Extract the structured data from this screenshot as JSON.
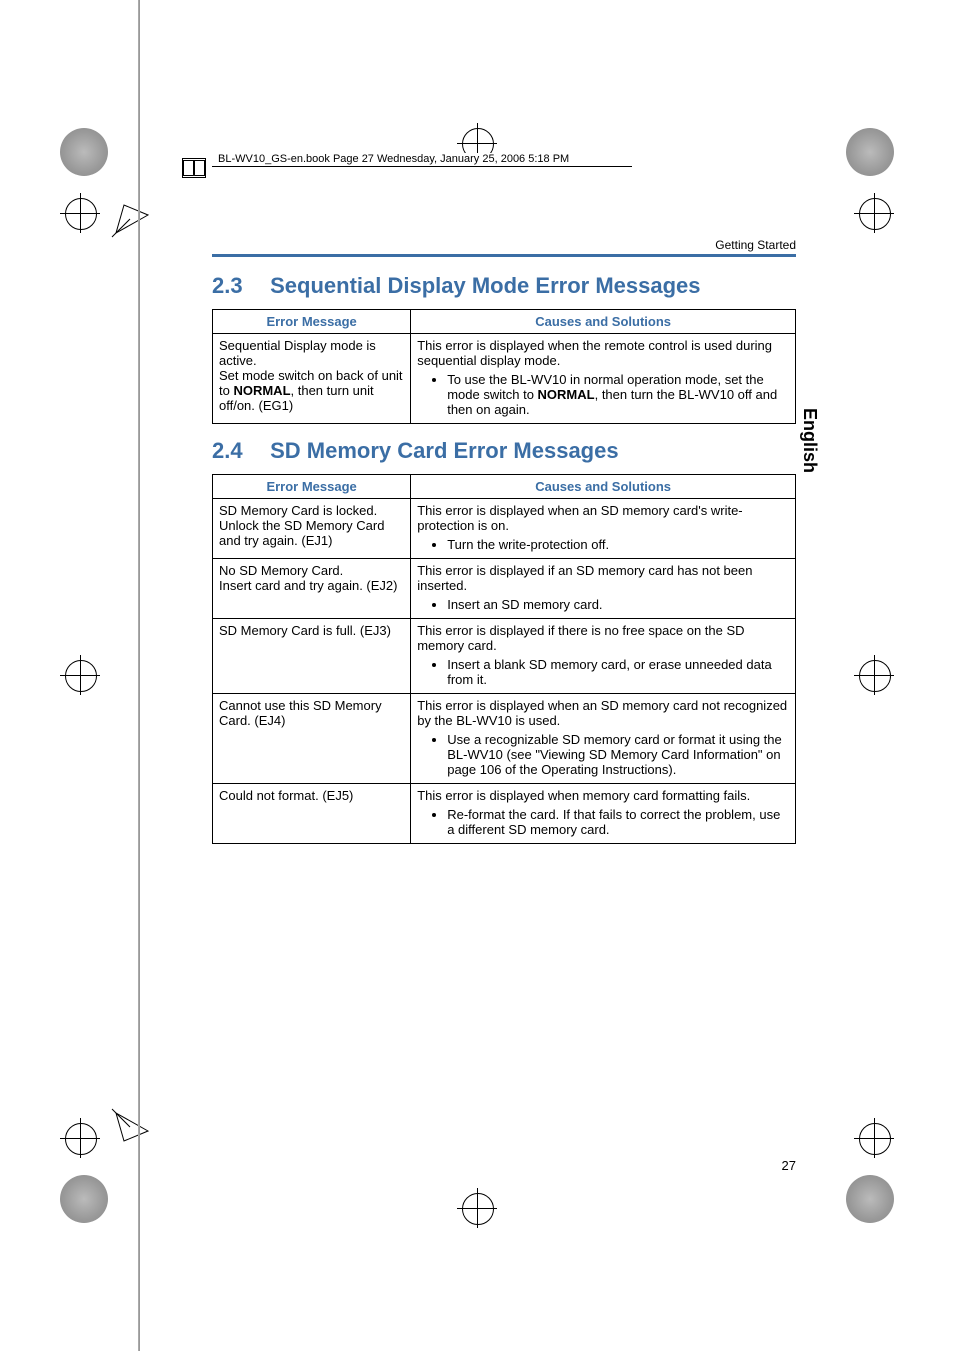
{
  "frameMaker": {
    "bookInfo": "BL-WV10_GS-en.book  Page 27  Wednesday, January 25, 2006  5:18 PM"
  },
  "runningHead": "Getting Started",
  "sideTab": "English",
  "pageNumber": "27",
  "section23": {
    "number": "2.3",
    "title": "Sequential Display Mode Error Messages",
    "headers": {
      "c1": "Error Message",
      "c2": "Causes and Solutions"
    },
    "row1": {
      "msgLine1": "Sequential Display mode is active.",
      "msgLine2a": "Set mode switch on back of unit to ",
      "msgLine2bold": "NORMAL",
      "msgLine2b": ", then turn unit off/on. (EG1)",
      "explain": "This error is displayed when the remote control is used during sequential display mode.",
      "bullet1a": "To use the BL-WV10 in normal operation mode, set the mode switch to ",
      "bullet1bold": "NORMAL",
      "bullet1b": ", then turn the BL-WV10 off and then on again."
    }
  },
  "section24": {
    "number": "2.4",
    "title": "SD Memory Card Error Messages",
    "headers": {
      "c1": "Error Message",
      "c2": "Causes and Solutions"
    },
    "rows": [
      {
        "msg1": "SD Memory Card is locked.",
        "msg2": "Unlock the SD Memory Card and try again. (EJ1)",
        "explain": "This error is displayed when an SD memory card's write-protection is on.",
        "bullet": "Turn the write-protection off."
      },
      {
        "msg1": "No SD Memory Card.",
        "msg2": "Insert card and try again. (EJ2)",
        "explain": "This error is displayed if an SD memory card has not been inserted.",
        "bullet": "Insert an SD memory card."
      },
      {
        "msg1": "SD Memory Card is full. (EJ3)",
        "msg2": "",
        "explain": "This error is displayed if there is no free space on the SD memory card.",
        "bullet": "Insert a blank SD memory card, or erase unneeded data from it."
      },
      {
        "msg1": "Cannot use this SD Memory Card. (EJ4)",
        "msg2": "",
        "explain": "This error is displayed when an SD memory card not recognized by the BL-WV10 is used.",
        "bullet": "Use a recognizable SD memory card or format it using the BL-WV10 (see \"Viewing SD Memory Card Information\" on page 106 of the Operating Instructions)."
      },
      {
        "msg1": "Could not format. (EJ5)",
        "msg2": "",
        "explain": "This error is displayed when memory card formatting fails.",
        "bullet": "Re-format the card. If that fails to correct the problem, use a different SD memory card."
      }
    ]
  }
}
